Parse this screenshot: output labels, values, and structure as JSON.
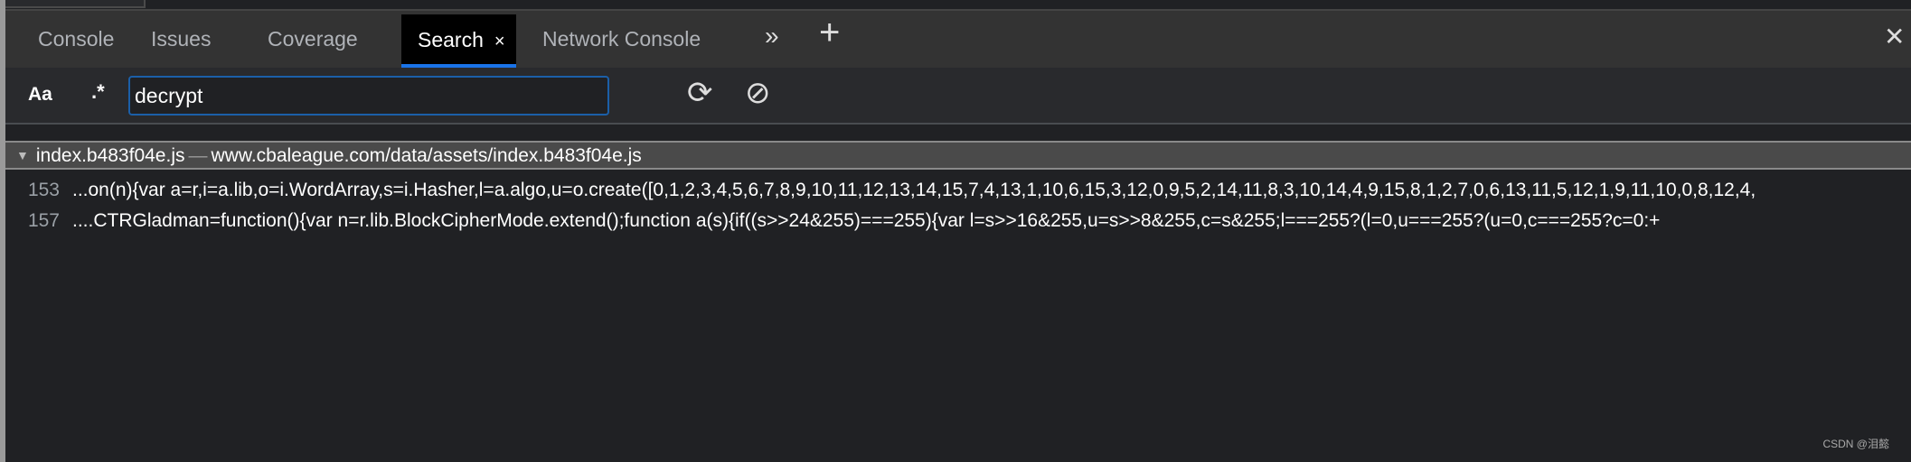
{
  "tabs": [
    {
      "label": "Console"
    },
    {
      "label": "Issues"
    },
    {
      "label": "Coverage"
    },
    {
      "label": "Search",
      "active": true
    },
    {
      "label": "Network Console"
    }
  ],
  "icons": {
    "more_tabs": "»",
    "add_tab": "+",
    "close_panel": "✕",
    "close_tab": "×",
    "refresh": "⟳",
    "clear": "⊘",
    "expand": "▼"
  },
  "search": {
    "match_case": "Aa",
    "regex": ".*",
    "query": "decrypt"
  },
  "results": {
    "file": "index.b483f04e.js",
    "separator": "—",
    "url": "www.cbaleague.com/data/assets/index.b483f04e.js",
    "lines": [
      {
        "number": "153",
        "text": "...on(n){var a=r,i=a.lib,o=i.WordArray,s=i.Hasher,l=a.algo,u=o.create([0,1,2,3,4,5,6,7,8,9,10,11,12,13,14,15,7,4,13,1,10,6,15,3,12,0,9,5,2,14,11,8,3,10,14,4,9,15,8,1,2,7,0,6,13,11,5,12,1,9,11,10,0,8,12,4,"
      },
      {
        "number": "157",
        "text": "....CTRGladman=function(){var n=r.lib.BlockCipherMode.extend();function a(s){if((s>>24&255)===255){var l=s>>16&255,u=s>>8&255,c=s&255;l===255?(l=0,u===255?(u=0,c===255?c=0:+"
      }
    ]
  },
  "watermark": "CSDN @泪懿",
  "colors": {
    "accent": "#1a73e8",
    "background": "#202124"
  }
}
